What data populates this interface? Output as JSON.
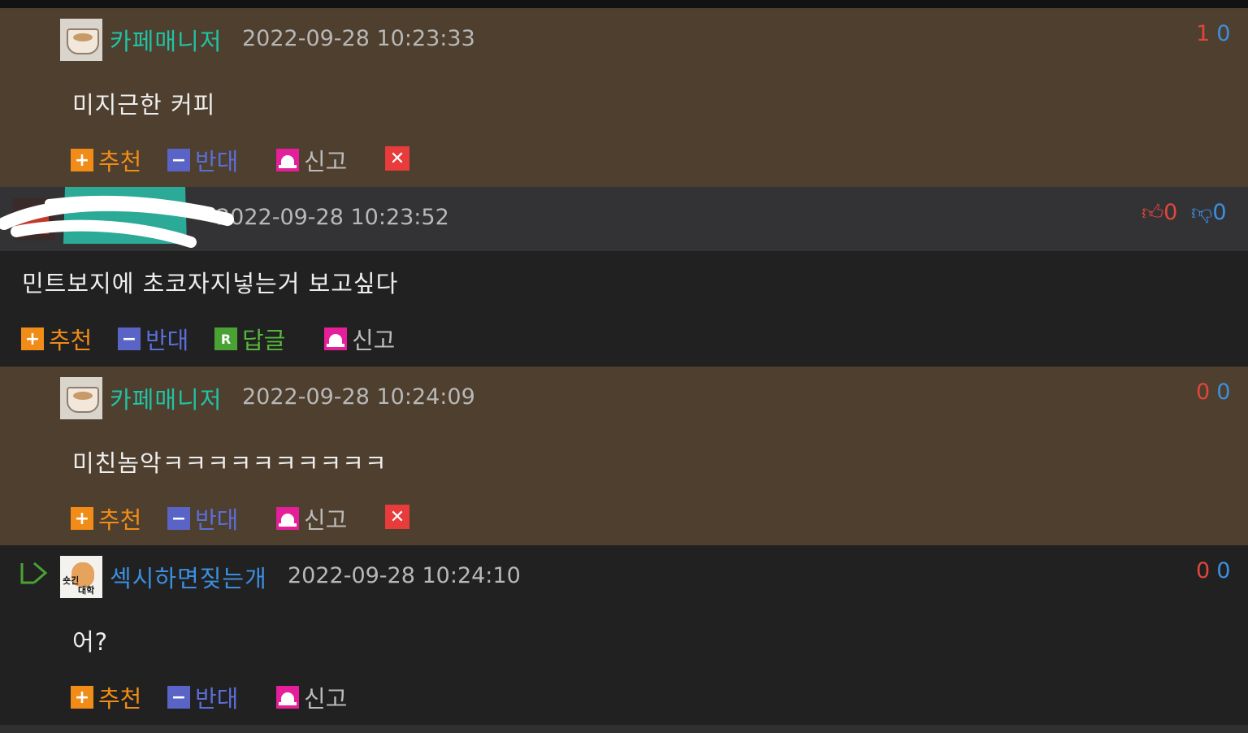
{
  "colors": {
    "owner_bg": "#4e3f2e",
    "dark_bg": "#212121",
    "teal_nick": "#21c2a5",
    "blue_nick": "#3c8fe0",
    "upvote": "#e0463c",
    "downvote": "#3c8fe0"
  },
  "comments": [
    {
      "nickname": "카페매니저",
      "date": "2022-09-28 10:23:33",
      "text": "미지근한 커피",
      "up": "1",
      "down": "0",
      "actions": {
        "recommend": "추천",
        "oppose": "반대",
        "report": "신고",
        "delete_icon": "close-icon"
      }
    },
    {
      "nickname": "",
      "date": "2022-09-28 10:23:52",
      "text": "민트보지에 초코자지넣는거 보고싶다",
      "up": "0",
      "down": "0",
      "actions": {
        "recommend": "추천",
        "oppose": "반대",
        "reply": "답글",
        "reply_icon_letter": "R",
        "report": "신고"
      }
    },
    {
      "nickname": "카페매니저",
      "date": "2022-09-28 10:24:09",
      "text": "미친놈악ㅋㅋㅋㅋㅋㅋㅋㅋㅋㅋ",
      "up": "0",
      "down": "0",
      "actions": {
        "recommend": "추천",
        "oppose": "반대",
        "report": "신고",
        "delete_icon": "close-icon"
      }
    },
    {
      "nickname": "섹시하면짖는개",
      "avatar_text_1": "숏긴",
      "avatar_text_2": "대학",
      "date": "2022-09-28 10:24:10",
      "text": "어?",
      "up": "0",
      "down": "0",
      "actions": {
        "recommend": "추천",
        "oppose": "반대",
        "report": "신고"
      }
    }
  ]
}
